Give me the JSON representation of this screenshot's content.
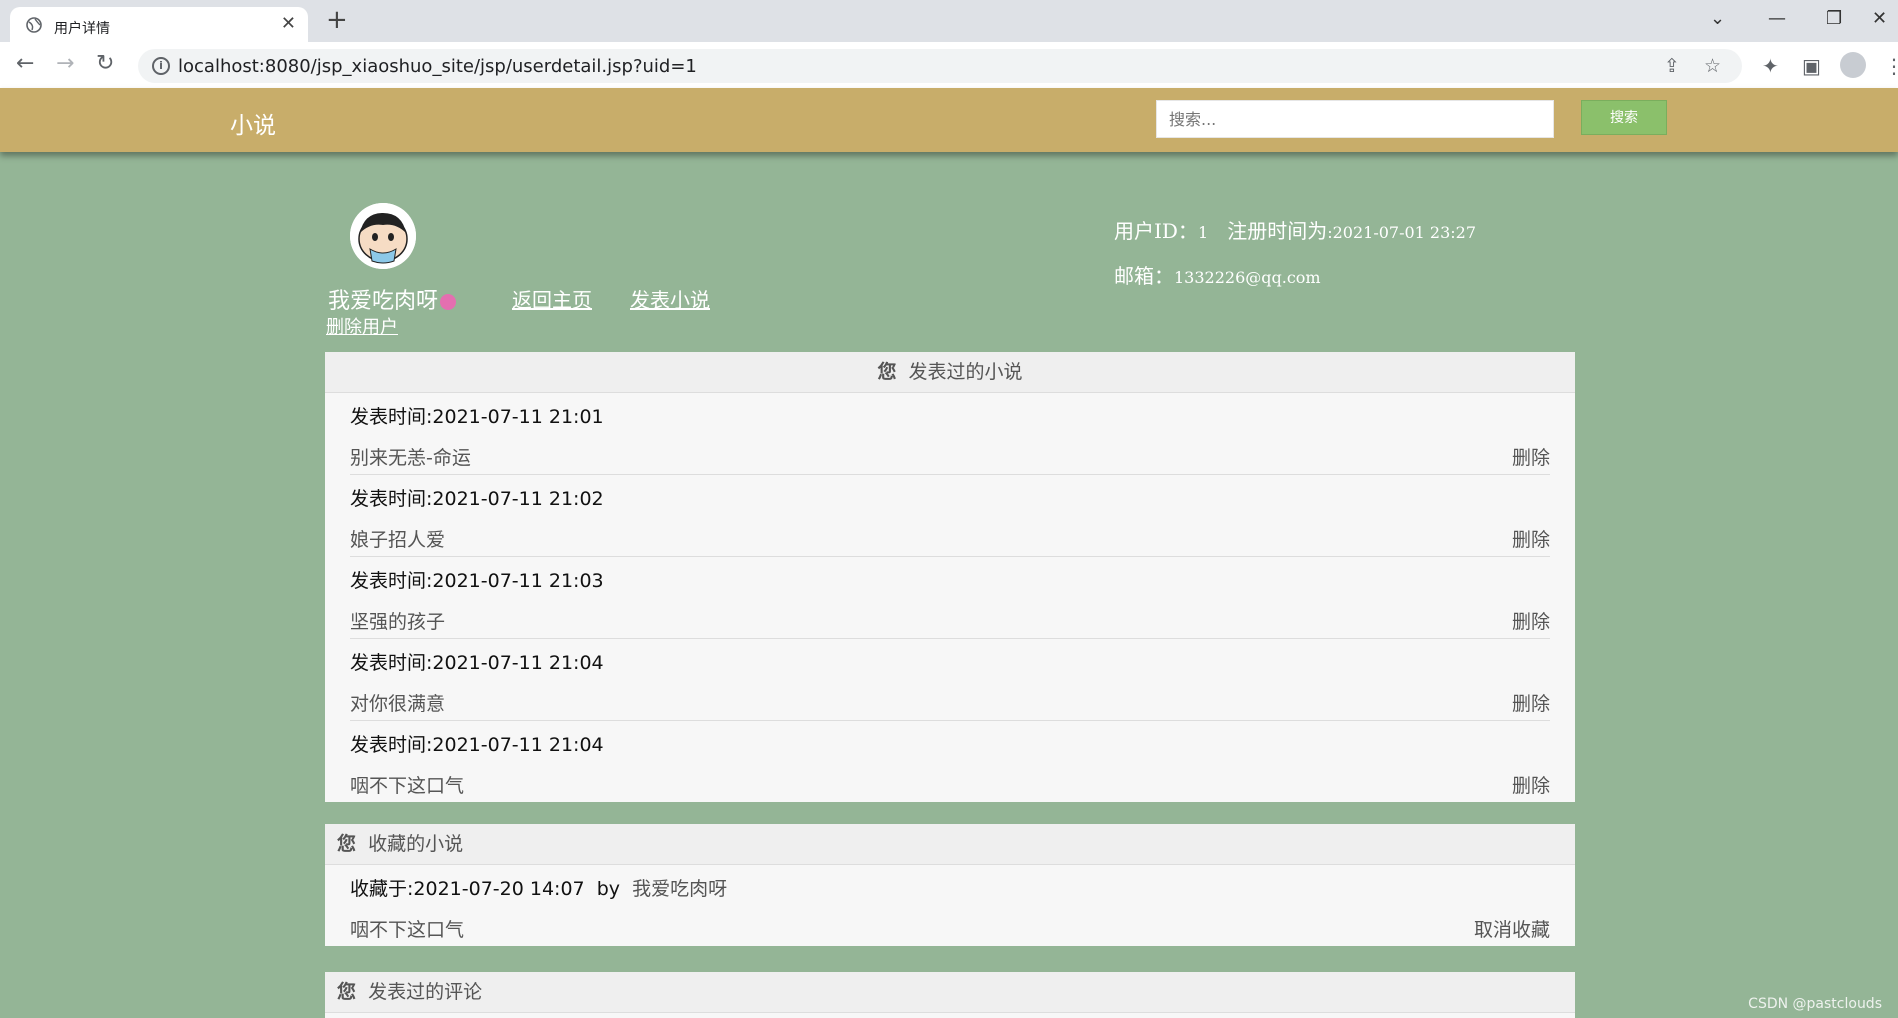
{
  "browser": {
    "tab_title": "用户详情",
    "url": "localhost:8080/jsp_xiaoshuo_site/jsp/userdetail.jsp?uid=1"
  },
  "header": {
    "brand": "小说",
    "search_placeholder": "搜索...",
    "search_button": "搜索"
  },
  "profile": {
    "username": "我爱吃肉呀",
    "home_link": "返回主页",
    "publish_link": "发表小说",
    "delete_user_link": "删除用户",
    "user_id_label": "用户ID：",
    "user_id": "1",
    "register_label": "注册时间为",
    "register_time": ":2021-07-01 23:27",
    "email_label": "邮箱：",
    "email": "1332226@qq.com"
  },
  "published": {
    "you": "您",
    "title": "发表过的小说",
    "items": [
      {
        "time": "发表时间:2021-07-11 21:01",
        "name": "别来无恙-命运",
        "action": "删除"
      },
      {
        "time": "发表时间:2021-07-11 21:02",
        "name": "娘子招人爱",
        "action": "删除"
      },
      {
        "time": "发表时间:2021-07-11 21:03",
        "name": "坚强的孩子",
        "action": "删除"
      },
      {
        "time": "发表时间:2021-07-11 21:04",
        "name": "对你很满意",
        "action": "删除"
      },
      {
        "time": "发表时间:2021-07-11 21:04",
        "name": "咽不下这口气",
        "action": "删除"
      }
    ]
  },
  "favorites": {
    "you": "您",
    "title": "收藏的小说",
    "items": [
      {
        "time": "收藏于:2021-07-20 14:07",
        "by": "by",
        "author": "我爱吃肉呀",
        "name": "咽不下这口气",
        "action": "取消收藏"
      }
    ]
  },
  "comments": {
    "you": "您",
    "title": "发表过的评论"
  },
  "watermark": "CSDN @pastclouds",
  "colors": {
    "page_bg": "#94b596",
    "header_bg": "#c8ad6a",
    "search_btn": "#8bc06b"
  }
}
